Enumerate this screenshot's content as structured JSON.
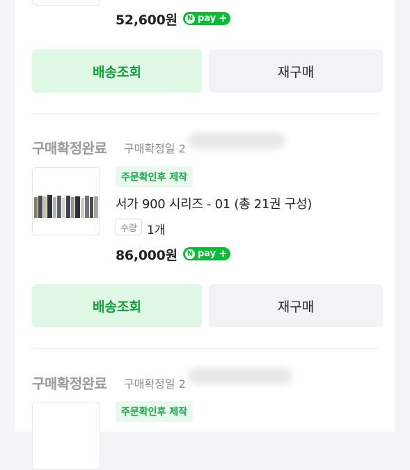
{
  "orders": [
    {
      "price": "52,600원",
      "npay": {
        "badge": "pay",
        "n": "N",
        "plus": "+"
      },
      "buttons": {
        "track": "배송조회",
        "rebuy": "재구매"
      }
    },
    {
      "status": "구매확정완료",
      "date_label": "구매확정일 2",
      "tag": "주문확인후 제작",
      "title": "서가 900 시리즈 - 01 (총 21권 구성)",
      "qty_label": "수량",
      "qty": "1개",
      "price": "86,000원",
      "npay": {
        "badge": "pay",
        "n": "N",
        "plus": "+"
      },
      "buttons": {
        "track": "배송조회",
        "rebuy": "재구매"
      }
    },
    {
      "status": "구매확정완료",
      "date_label": "구매확정일 2",
      "tag": "주문확인후 제작"
    }
  ],
  "colors": {
    "accent": "#06be34",
    "accent_text": "#0f9d3a",
    "tag_bg": "#e9f9ee"
  }
}
